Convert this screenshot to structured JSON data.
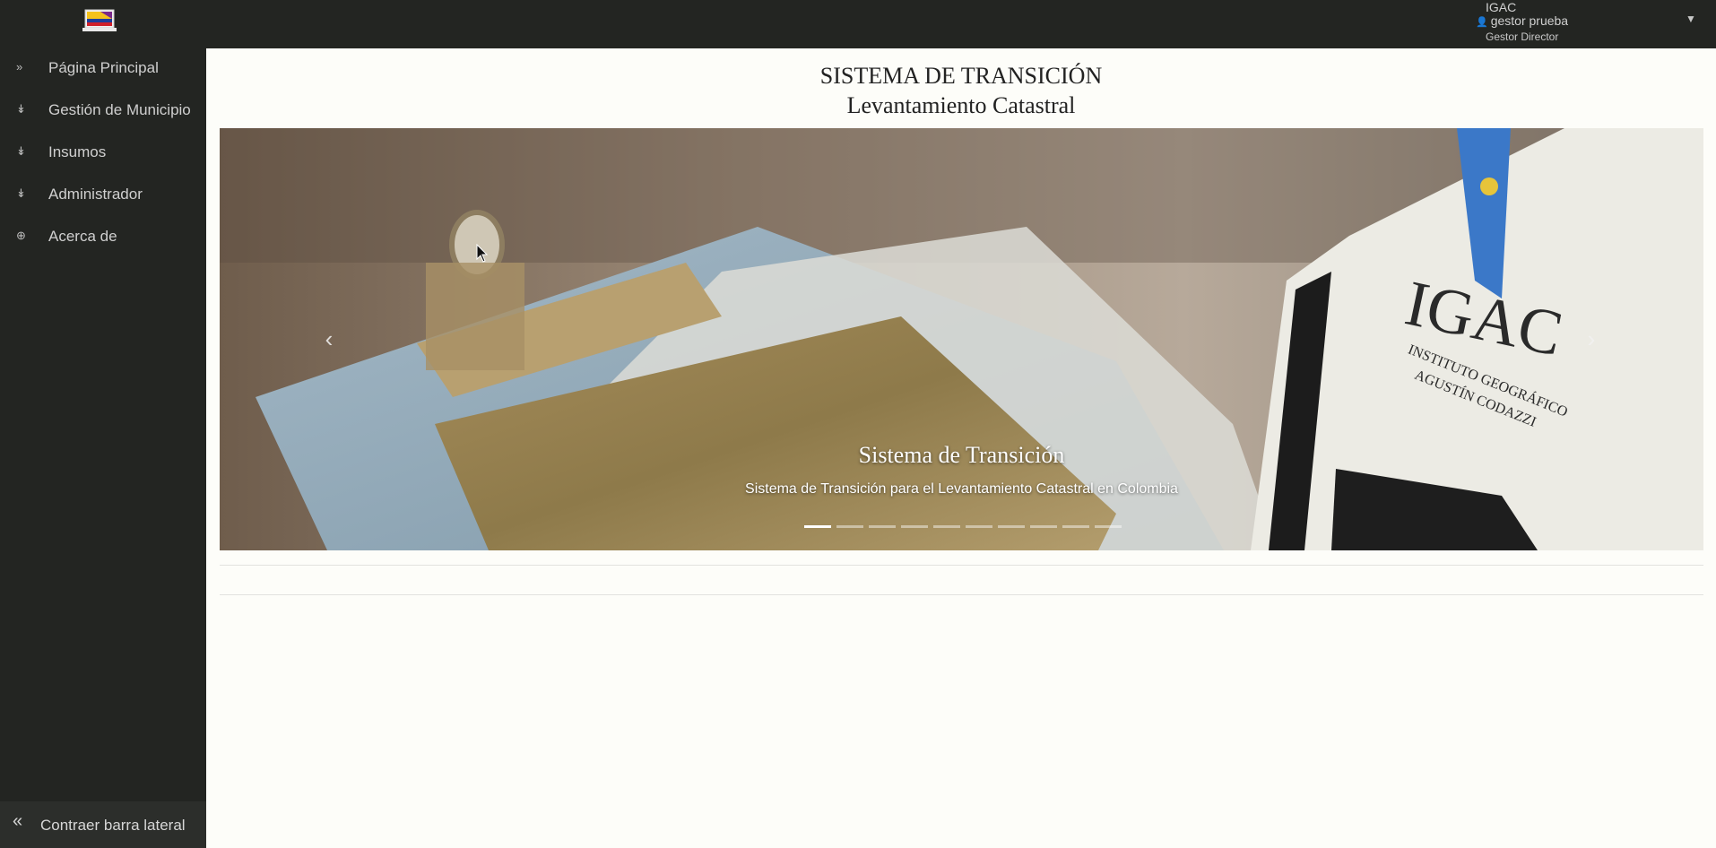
{
  "header": {
    "organization": "IGAC",
    "user_name": "gestor prueba",
    "user_role": "Gestor Director",
    "person_icon": "user-icon",
    "caret_icon": "caret-down-icon",
    "logo_icon": "laptop-flag-logo"
  },
  "sidebar": {
    "items": [
      {
        "label": "Página Principal",
        "icon": "double-chevron-right-icon"
      },
      {
        "label": "Gestión de Municipio",
        "icon": "double-chevron-down-icon"
      },
      {
        "label": "Insumos",
        "icon": "double-chevron-down-icon"
      },
      {
        "label": "Administrador",
        "icon": "double-chevron-down-icon"
      },
      {
        "label": "Acerca de",
        "icon": "plus-circle-icon"
      }
    ],
    "collapse_label": "Contraer barra lateral",
    "collapse_icon": "double-chevron-left-icon"
  },
  "main": {
    "title": "SISTEMA DE TRANSICIÓN",
    "subtitle": "Levantamiento Catastral"
  },
  "carousel": {
    "caption_title": "Sistema de Transición",
    "caption_text": "Sistema de Transición para el Levantamiento Catastral en Colombia",
    "image_badge_text": "IGAC",
    "image_badge_subtext": "INSTITUTO GEOGRÁFICO AGUSTÍN CODAZZI",
    "prev_icon": "chevron-left-icon",
    "next_icon": "chevron-right-icon",
    "slide_count": 10,
    "active_slide": 1
  },
  "colors": {
    "sidebar_bg": "#232522",
    "content_bg": "#fdfdf9",
    "text_light": "#cfcfcf"
  }
}
